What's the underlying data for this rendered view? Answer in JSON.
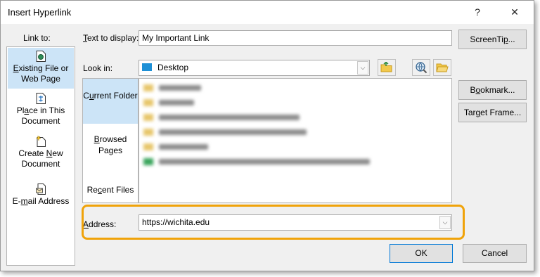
{
  "window": {
    "title": "Insert Hyperlink",
    "help_glyph": "?",
    "close_glyph": "✕"
  },
  "link_to": {
    "label": "Link to:",
    "items": [
      {
        "label_pre": "",
        "label_u": "E",
        "label_post": "xisting File or Web Page",
        "icon": "document-globe-icon"
      },
      {
        "label_pre": "Pl",
        "label_u": "a",
        "label_post": "ce in This Document",
        "icon": "document-anchor-icon"
      },
      {
        "label_pre": "Create ",
        "label_u": "N",
        "label_post": "ew Document",
        "icon": "new-document-icon"
      },
      {
        "label_pre": "E-",
        "label_u": "m",
        "label_post": "ail Address",
        "icon": "email-icon"
      }
    ]
  },
  "text_to_display": {
    "label_u": "T",
    "label_rest": "ext to display:",
    "value": "My Important Link"
  },
  "look_in": {
    "label_pre": "Look in",
    "label_u": "",
    "label_post": ":",
    "value": "Desktop"
  },
  "nav": {
    "items": [
      {
        "pre": "C",
        "u": "u",
        "post": "rrent Folder"
      },
      {
        "pre": "",
        "u": "B",
        "post": "rowsed Pages"
      },
      {
        "pre": "Re",
        "u": "c",
        "post": "ent Files"
      }
    ]
  },
  "address": {
    "label_u": "A",
    "label_rest": "ddress:",
    "value": "https://wichita.edu"
  },
  "buttons": {
    "screentip_pre": "ScreenTi",
    "screentip_u": "p",
    "screentip_post": "...",
    "bookmark_pre": "B",
    "bookmark_u": "o",
    "bookmark_post": "okmark...",
    "target_pre": "Tar",
    "target_u": "g",
    "target_post": "et Frame...",
    "ok": "OK",
    "cancel": "Cancel"
  },
  "colors": {
    "accent_highlight": "#f0a30a",
    "selection": "#cce4f7",
    "dialog_bg": "#f0f0f0"
  }
}
